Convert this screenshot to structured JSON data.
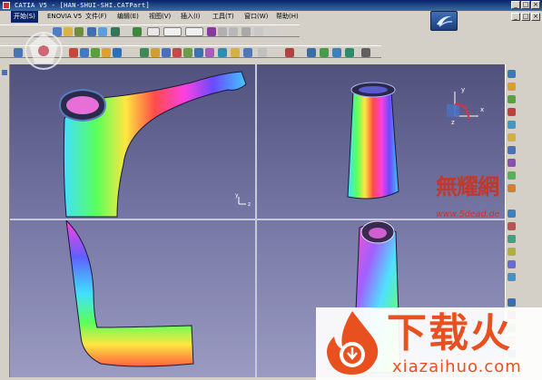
{
  "window": {
    "title": "CATIA V5 - [HAN-SHUI-SHI.CATPart]",
    "controls": [
      "_",
      "□",
      "×"
    ]
  },
  "menubar": {
    "items": [
      {
        "label": "开始(S)",
        "active": true
      },
      {
        "label": "ENOVIA V5",
        "active": false
      },
      {
        "label": "文件(F)",
        "active": false
      },
      {
        "label": "编辑(E)",
        "active": false
      },
      {
        "label": "视图(V)",
        "active": false
      },
      {
        "label": "插入(I)",
        "active": false
      },
      {
        "label": "工具(T)",
        "active": false
      },
      {
        "label": "窗口(W)",
        "active": false
      },
      {
        "label": "帮助(H)",
        "active": false
      }
    ],
    "doc_controls": [
      "_",
      "□",
      "×"
    ]
  },
  "viewports": {
    "compass_axes": {
      "x": "x",
      "y": "y",
      "z": "z"
    },
    "top_left_axes": {
      "y": "y",
      "z": "z"
    }
  },
  "watermarks": {
    "site_cn": "無耀網",
    "site_url": "www.5dead.de",
    "brand_cn": "下载火",
    "brand_url": "xiazaihuo.com"
  },
  "colors": {
    "titlebar": "#0a246a",
    "menu_active": "#0a246a",
    "viewport_bg_top": "#51517e",
    "viewport_bg_bottom": "#9a9bc2",
    "brand_orange": "#e8511f",
    "watermark_red": "#c2382f"
  }
}
